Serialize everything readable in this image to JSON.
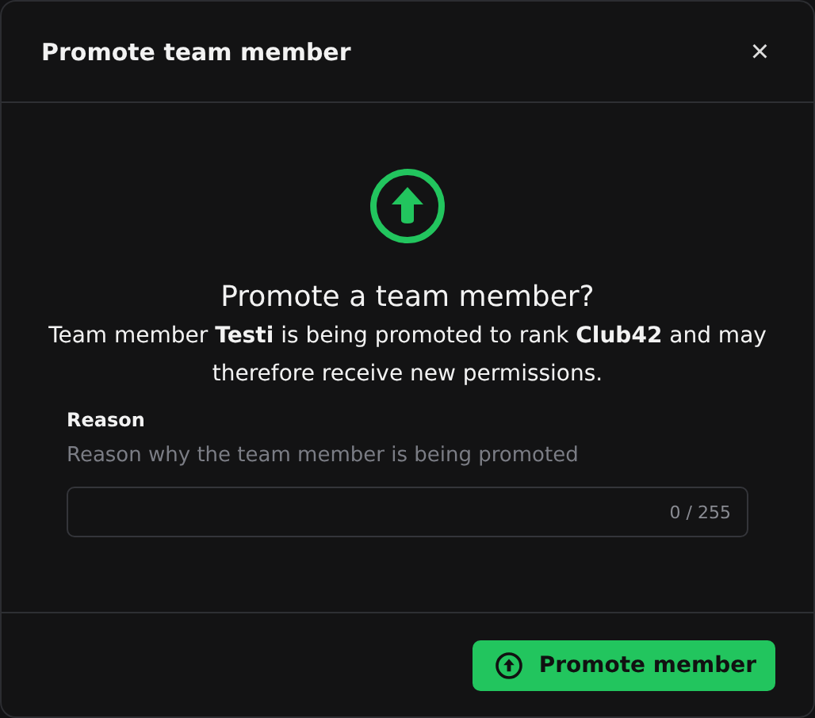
{
  "dialog": {
    "title": "Promote team member",
    "close": "×"
  },
  "confirmation": {
    "heading": "Promote a team member?",
    "message": "Team member **Testi** is being promoted to rank **Club42** and may therefore receive new permissions."
  },
  "reason": {
    "label": "Reason",
    "description": "Reason why the team member is being promoted",
    "counter": "0 / 255"
  },
  "buttons": [
    {
      "label": "Promote member",
      "kind": "primary"
    }
  ]
}
